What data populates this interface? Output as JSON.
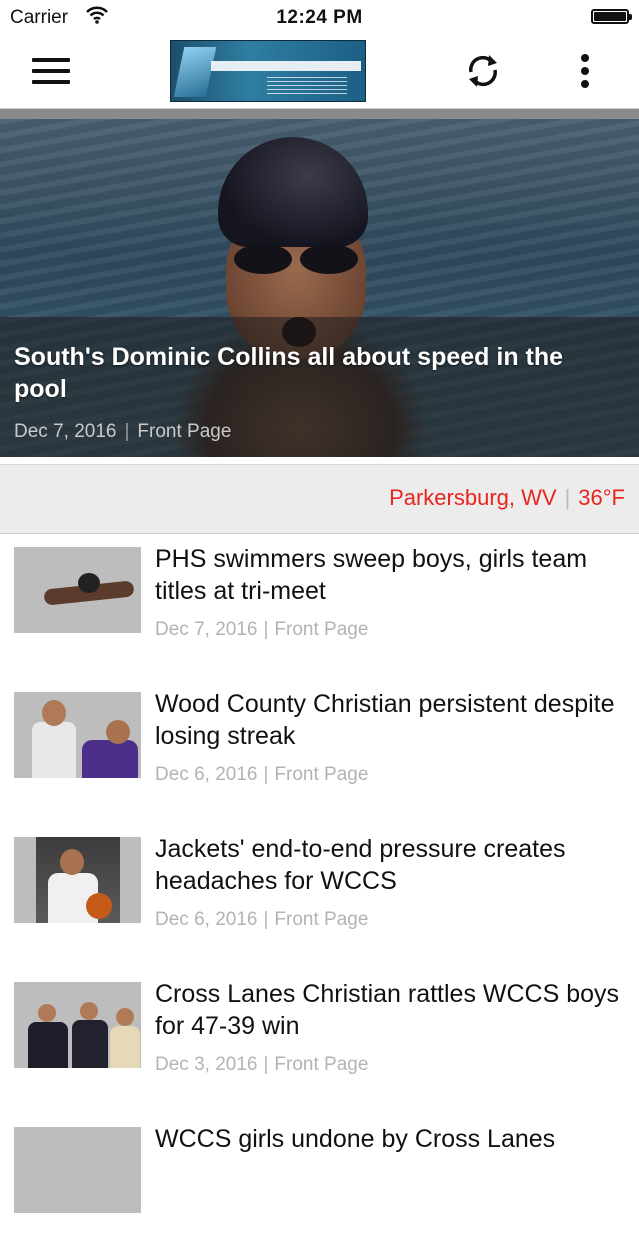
{
  "status_bar": {
    "carrier": "Carrier",
    "time": "12:24 PM"
  },
  "nav": {
    "menu_icon": "hamburger-menu-icon",
    "refresh_icon": "refresh-icon",
    "more_icon": "vertical-ellipsis-icon"
  },
  "hero": {
    "title": "South's Dominic Collins all about speed in the pool",
    "date": "Dec 7, 2016",
    "category": "Front Page"
  },
  "location": {
    "city": "Parkersburg, WV",
    "temperature": "36°F",
    "color": "#e8261f"
  },
  "articles": [
    {
      "title": "PHS swimmers sweep boys, girls team titles at tri-meet",
      "date": "Dec 7, 2016",
      "category": "Front Page"
    },
    {
      "title": "Wood County Christian persistent despite losing streak",
      "date": "Dec 6, 2016",
      "category": "Front Page"
    },
    {
      "title": "Jackets' end-to-end pressure creates headaches for WCCS",
      "date": "Dec 6, 2016",
      "category": "Front Page"
    },
    {
      "title": "Cross Lanes Christian rattles WCCS boys for 47-39 win",
      "date": "Dec 3, 2016",
      "category": "Front Page"
    },
    {
      "title": "WCCS girls undone by Cross Lanes",
      "date": "",
      "category": ""
    }
  ]
}
